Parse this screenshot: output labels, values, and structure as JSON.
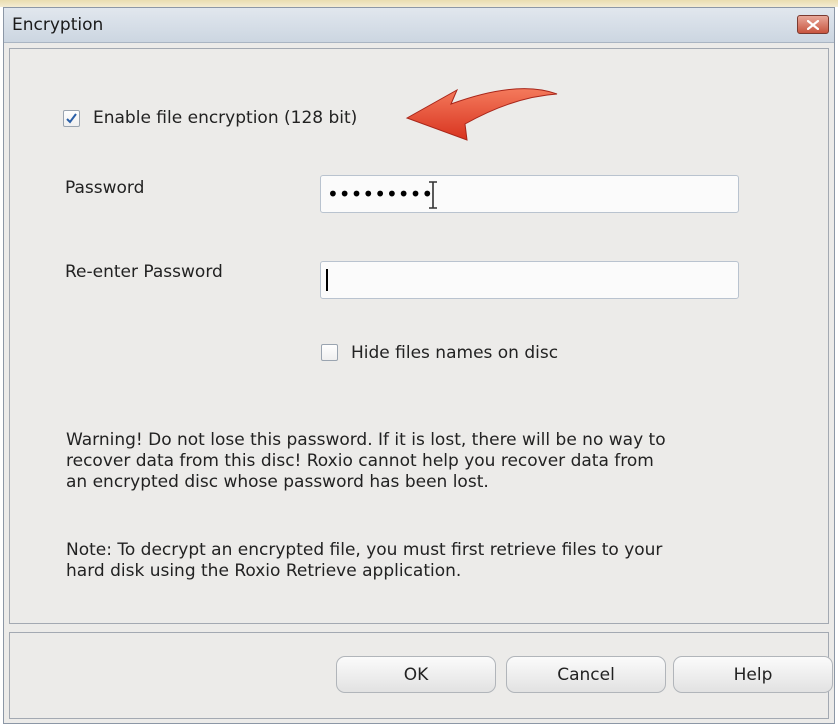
{
  "window": {
    "title": "Encryption"
  },
  "encryption": {
    "enable_label": "Enable file encryption (128 bit)",
    "enable_checked": true
  },
  "password": {
    "label": "Password",
    "value": "•••••••••"
  },
  "reenter": {
    "label": "Re-enter Password",
    "value": ""
  },
  "hide_names": {
    "label": "Hide files names on disc",
    "checked": false
  },
  "warning": {
    "line1": "Warning! Do not lose this password.  If it is lost, there will be no way to",
    "line2": "recover data from this disc! Roxio cannot help you recover data from",
    "line3": "an encrypted disc whose password has been lost."
  },
  "note": {
    "line1": "Note: To decrypt an encrypted file, you must first retrieve files to your",
    "line2": "hard disk using the Roxio Retrieve application."
  },
  "buttons": {
    "ok": "OK",
    "cancel": "Cancel",
    "help": "Help"
  },
  "colors": {
    "arrow": "#e8412a",
    "close_button": "#c8553f"
  }
}
